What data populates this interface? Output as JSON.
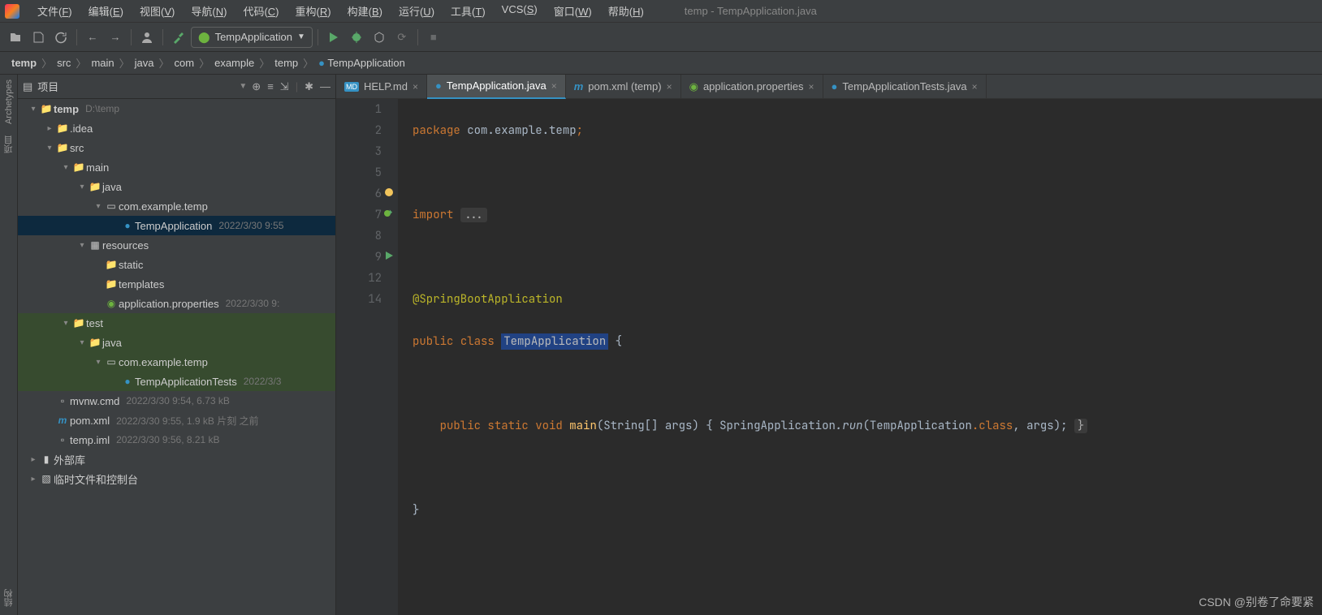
{
  "window": {
    "title": "temp - TempApplication.java"
  },
  "menubar": [
    "文件(F)",
    "编辑(E)",
    "视图(V)",
    "导航(N)",
    "代码(C)",
    "重构(R)",
    "构建(B)",
    "运行(U)",
    "工具(T)",
    "VCS(S)",
    "窗口(W)",
    "帮助(H)"
  ],
  "toolbar": {
    "run_config": "TempApplication"
  },
  "breadcrumbs": [
    "temp",
    "src",
    "main",
    "java",
    "com",
    "example",
    "temp",
    "TempApplication"
  ],
  "project_panel": {
    "title": "项目",
    "tree": [
      {
        "d": 0,
        "a": "v",
        "t": "root",
        "text": "temp",
        "meta": "D:\\temp"
      },
      {
        "d": 1,
        "a": ">",
        "t": "folder",
        "text": ".idea"
      },
      {
        "d": 1,
        "a": "v",
        "t": "folder",
        "text": "src"
      },
      {
        "d": 2,
        "a": "v",
        "t": "folder",
        "text": "main"
      },
      {
        "d": 3,
        "a": "v",
        "t": "folder-blue",
        "text": "java"
      },
      {
        "d": 4,
        "a": "v",
        "t": "package",
        "text": "com.example.temp"
      },
      {
        "d": 5,
        "a": "",
        "t": "class",
        "text": "TempApplication",
        "meta": "2022/3/30 9:55",
        "sel": "blue"
      },
      {
        "d": 3,
        "a": "v",
        "t": "resources",
        "text": "resources"
      },
      {
        "d": 4,
        "a": "",
        "t": "folder",
        "text": "static"
      },
      {
        "d": 4,
        "a": "",
        "t": "folder",
        "text": "templates"
      },
      {
        "d": 4,
        "a": "",
        "t": "props",
        "text": "application.properties",
        "meta": "2022/3/30 9:"
      },
      {
        "d": 2,
        "a": "v",
        "t": "folder",
        "text": "test",
        "sel": "green"
      },
      {
        "d": 3,
        "a": "v",
        "t": "folder-green",
        "text": "java",
        "sel": "green"
      },
      {
        "d": 4,
        "a": "v",
        "t": "package",
        "text": "com.example.temp",
        "sel": "green"
      },
      {
        "d": 5,
        "a": "",
        "t": "class",
        "text": "TempApplicationTests",
        "meta": "2022/3/3",
        "sel": "green"
      },
      {
        "d": 1,
        "a": "",
        "t": "file",
        "text": "mvnw.cmd",
        "meta": "2022/3/30 9:54, 6.73 kB"
      },
      {
        "d": 1,
        "a": "",
        "t": "maven",
        "text": "pom.xml",
        "meta": "2022/3/30 9:55, 1.9 kB 片刻 之前"
      },
      {
        "d": 1,
        "a": "",
        "t": "file",
        "text": "temp.iml",
        "meta": "2022/3/30 9:56, 8.21 kB"
      },
      {
        "d": 0,
        "a": ">",
        "t": "lib",
        "text": "外部库"
      },
      {
        "d": 0,
        "a": ">",
        "t": "scratch",
        "text": "临时文件和控制台"
      }
    ]
  },
  "tabs": [
    {
      "icon": "md",
      "label": "HELP.md",
      "active": false
    },
    {
      "icon": "class",
      "label": "TempApplication.java",
      "active": true
    },
    {
      "icon": "maven",
      "label": "pom.xml (temp)",
      "active": false
    },
    {
      "icon": "props",
      "label": "application.properties",
      "active": false
    },
    {
      "icon": "class",
      "label": "TempApplicationTests.java",
      "active": false
    }
  ],
  "code": {
    "line_numbers": [
      "1",
      "2",
      "3",
      "5",
      "6",
      "7",
      "8",
      "9",
      "12",
      "14"
    ],
    "l1_pkg": "package",
    "l1_path": "com.example.temp",
    "l3_imp": "import",
    "l3_dots": "...",
    "l6_ann": "@SpringBootApplication",
    "l7_pub": "public",
    "l7_cls": "class",
    "l7_name": "TempApplication",
    "l7_brace": "{",
    "l9_pub": "public",
    "l9_static": "static",
    "l9_void": "void",
    "l9_main": "main",
    "l9_args": "(String[] args)",
    "l9_open": "{",
    "l9_call": "SpringApplication",
    "l9_run": ".run",
    "l9_p": "(TempApplication",
    "l9_class": ".class",
    "l9_rest": ", args); ",
    "l9_close": "}",
    "l12": "}"
  },
  "left_strip": [
    "Archetypes",
    "项目"
  ],
  "bottom_strip": "结构",
  "watermark": "CSDN @别卷了命要紧"
}
